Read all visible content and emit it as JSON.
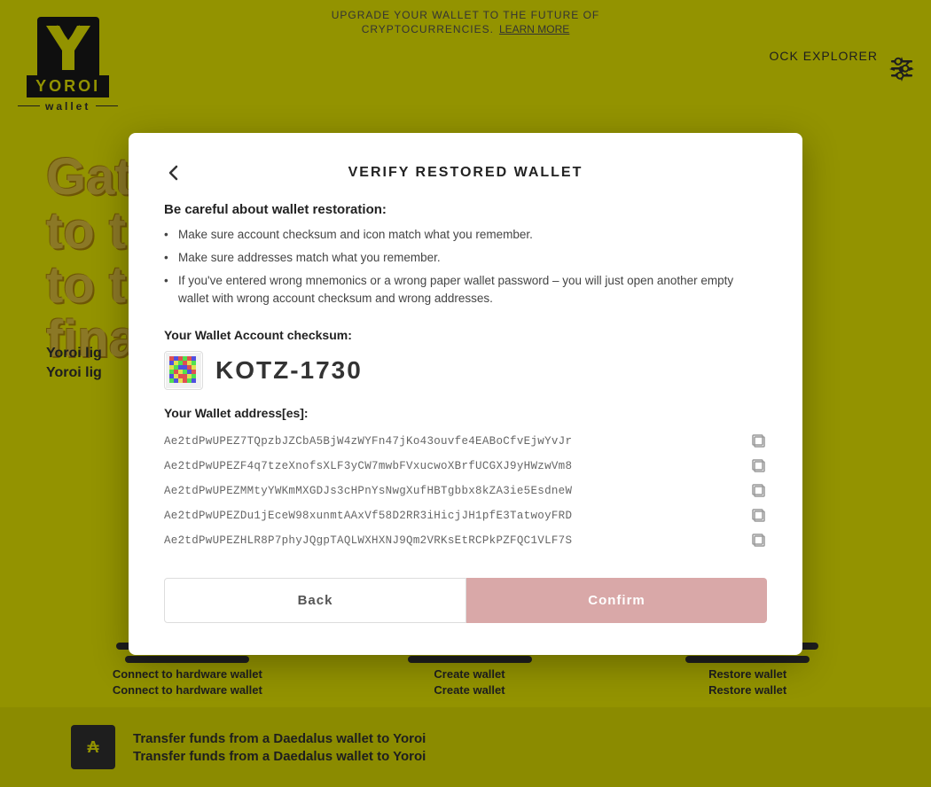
{
  "header": {
    "logo_text": "YOROI",
    "wallet_label": "wallet",
    "block_explorer": "OCK EXPLORER"
  },
  "nav_top": {
    "line1": "UPGRADE YOUR WALLET TO THE FUTURE OF",
    "line2": "CRYPTOCURRENCIES.",
    "link_text": "LEARN MORE"
  },
  "bg": {
    "title": "Gateway",
    "subtitle_line1": "Yoroi lig",
    "subtitle_line2": "Yoroi lig"
  },
  "modal": {
    "title": "VERIFY RESTORED WALLET",
    "back_icon": "←",
    "warning_title": "Be careful about wallet restoration:",
    "warnings": [
      "Make sure account checksum and icon match what you remember.",
      "Make sure addresses match what you remember.",
      "If you've entered wrong mnemonics or a wrong paper wallet password – you will just open another empty wallet with wrong account checksum and wrong addresses."
    ],
    "checksum_label": "Your Wallet Account checksum:",
    "checksum_value": "KOTZ-1730",
    "addresses_label": "Your Wallet address[es]:",
    "addresses": [
      "Ae2tdPwUPEZ7TQpzbJZCbA5BjW4zWYFn47jKo43ouvfe4EABoCfvEjwYvJr",
      "Ae2tdPwUPEZF4q7tzeXnofsXLF3yCW7mwbFVxucwoXBrfUCGXJ9yHWzwVm8",
      "Ae2tdPwUPEZMMtyYWKmMXGDJs3cHPnYsNwgXufHBTgbbx8kZA3ie5EsdneW",
      "Ae2tdPwUPEZDu1jEceW98xunmtAAxVf58D2RR3iHicjJH1pfE3TatwoyFRD",
      "Ae2tdPwUPEZHLR8P7phyJQgpTAQLWXHXNJ9Qm2VRKsEtRCPkPZFQC1VLF7S"
    ],
    "back_btn": "Back",
    "confirm_btn": "Confirm"
  },
  "bottom_cards": [
    {
      "label": "Connect to hardware wallet\nConnect to hardware wallet"
    },
    {
      "label": "Create wallet\nCreate wallet"
    },
    {
      "label": "Restore wallet\nRestore wallet"
    }
  ],
  "transfer": {
    "text_line1": "Transfer funds from a Daedalus wallet to Yoroi",
    "text_line2": "Transfer funds from a Daedalus wallet to Yoroi"
  }
}
